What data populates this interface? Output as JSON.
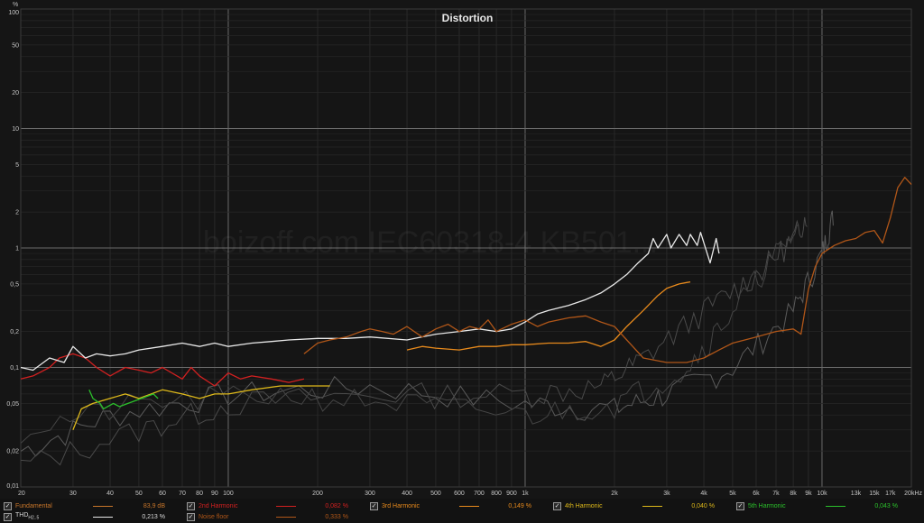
{
  "watermark": "boizoff.com IEC60318-4 KB501...",
  "chart_data": {
    "type": "line",
    "title": "Distortion",
    "yunit": "%",
    "xunit": "Hz",
    "xscale": "log",
    "yscale": "log",
    "xlim": [
      20,
      20000
    ],
    "ylim": [
      0.01,
      100
    ],
    "grid": true,
    "legend_placement": "bottom",
    "x_ticks": [
      {
        "v": 20,
        "t": "20"
      },
      {
        "v": 30,
        "t": "30"
      },
      {
        "v": 40,
        "t": "40"
      },
      {
        "v": 50,
        "t": "50"
      },
      {
        "v": 60,
        "t": "60"
      },
      {
        "v": 70,
        "t": "70"
      },
      {
        "v": 80,
        "t": "80"
      },
      {
        "v": 90,
        "t": "90"
      },
      {
        "v": 100,
        "t": "100"
      },
      {
        "v": 200,
        "t": "200"
      },
      {
        "v": 300,
        "t": "300"
      },
      {
        "v": 400,
        "t": "400"
      },
      {
        "v": 500,
        "t": "500"
      },
      {
        "v": 600,
        "t": "600"
      },
      {
        "v": 700,
        "t": "700"
      },
      {
        "v": 800,
        "t": "800"
      },
      {
        "v": 900,
        "t": "900"
      },
      {
        "v": 1000,
        "t": "1k"
      },
      {
        "v": 2000,
        "t": "2k"
      },
      {
        "v": 3000,
        "t": "3k"
      },
      {
        "v": 4000,
        "t": "4k"
      },
      {
        "v": 5000,
        "t": "5k"
      },
      {
        "v": 6000,
        "t": "6k"
      },
      {
        "v": 7000,
        "t": "7k"
      },
      {
        "v": 8000,
        "t": "8k"
      },
      {
        "v": 9000,
        "t": "9k"
      },
      {
        "v": 10000,
        "t": "10k"
      },
      {
        "v": 13000,
        "t": "13k"
      },
      {
        "v": 15000,
        "t": "15k"
      },
      {
        "v": 17000,
        "t": "17k"
      },
      {
        "v": 20000,
        "t": "20kHz"
      }
    ],
    "y_ticks": [
      {
        "v": 0.01,
        "t": "0,01"
      },
      {
        "v": 0.02,
        "t": "0,02"
      },
      {
        "v": 0.05,
        "t": "0,05"
      },
      {
        "v": 0.1,
        "t": "0,1"
      },
      {
        "v": 0.2,
        "t": "0,2"
      },
      {
        "v": 0.5,
        "t": "0,5"
      },
      {
        "v": 1,
        "t": "1"
      },
      {
        "v": 2,
        "t": "2"
      },
      {
        "v": 5,
        "t": "5"
      },
      {
        "v": 10,
        "t": "10"
      },
      {
        "v": 20,
        "t": "20"
      },
      {
        "v": 50,
        "t": "50"
      },
      {
        "v": 100,
        "t": "100"
      }
    ],
    "series": [
      {
        "name": "Fundamental",
        "color": "#c8762a",
        "value": "83,9 dB",
        "show_line": false,
        "points": []
      },
      {
        "name": "2nd Harmonic",
        "color": "#d22020",
        "value": "0,082 %",
        "points": [
          [
            20,
            0.08
          ],
          [
            22,
            0.085
          ],
          [
            25,
            0.1
          ],
          [
            27,
            0.12
          ],
          [
            30,
            0.13
          ],
          [
            33,
            0.12
          ],
          [
            36,
            0.1
          ],
          [
            40,
            0.085
          ],
          [
            45,
            0.1
          ],
          [
            50,
            0.095
          ],
          [
            55,
            0.09
          ],
          [
            60,
            0.1
          ],
          [
            70,
            0.08
          ],
          [
            75,
            0.1
          ],
          [
            80,
            0.085
          ],
          [
            90,
            0.07
          ],
          [
            100,
            0.09
          ],
          [
            110,
            0.08
          ],
          [
            120,
            0.085
          ],
          [
            140,
            0.08
          ],
          [
            160,
            0.075
          ],
          [
            180,
            0.08
          ]
        ]
      },
      {
        "name": "3rd Harmonic",
        "color": "#e88a1c",
        "value": "0,149 %",
        "points": [
          [
            400,
            0.14
          ],
          [
            450,
            0.15
          ],
          [
            500,
            0.145
          ],
          [
            600,
            0.14
          ],
          [
            700,
            0.15
          ],
          [
            800,
            0.15
          ],
          [
            900,
            0.155
          ],
          [
            1000,
            0.155
          ],
          [
            1200,
            0.16
          ],
          [
            1400,
            0.16
          ],
          [
            1600,
            0.165
          ],
          [
            1800,
            0.15
          ],
          [
            2000,
            0.17
          ],
          [
            2200,
            0.22
          ],
          [
            2500,
            0.3
          ],
          [
            2800,
            0.4
          ],
          [
            3000,
            0.46
          ],
          [
            3300,
            0.5
          ],
          [
            3600,
            0.52
          ]
        ]
      },
      {
        "name": "4th Harmonic",
        "color": "#ddb81a",
        "value": "0,040 %",
        "points": [
          [
            30,
            0.03
          ],
          [
            32,
            0.045
          ],
          [
            35,
            0.05
          ],
          [
            45,
            0.06
          ],
          [
            50,
            0.055
          ],
          [
            60,
            0.065
          ],
          [
            70,
            0.06
          ],
          [
            80,
            0.055
          ],
          [
            90,
            0.06
          ],
          [
            100,
            0.06
          ],
          [
            120,
            0.065
          ],
          [
            150,
            0.07
          ],
          [
            180,
            0.07
          ],
          [
            220,
            0.07
          ]
        ]
      },
      {
        "name": "5th Harmonic",
        "color": "#2bc02b",
        "value": "0,043 %",
        "points": [
          [
            34,
            0.065
          ],
          [
            35,
            0.055
          ],
          [
            37,
            0.05
          ],
          [
            38,
            0.045
          ],
          [
            41,
            0.05
          ],
          [
            43,
            0.047
          ],
          [
            56,
            0.06
          ],
          [
            58,
            0.055
          ]
        ]
      },
      {
        "name": "THD",
        "sub": "H2..5",
        "color": "#e8e8e8",
        "value": "0,213 %",
        "points": [
          [
            20,
            0.1
          ],
          [
            22,
            0.095
          ],
          [
            25,
            0.12
          ],
          [
            28,
            0.11
          ],
          [
            30,
            0.15
          ],
          [
            33,
            0.12
          ],
          [
            36,
            0.13
          ],
          [
            40,
            0.125
          ],
          [
            45,
            0.13
          ],
          [
            50,
            0.14
          ],
          [
            60,
            0.15
          ],
          [
            70,
            0.16
          ],
          [
            80,
            0.15
          ],
          [
            90,
            0.16
          ],
          [
            100,
            0.15
          ],
          [
            120,
            0.16
          ],
          [
            140,
            0.165
          ],
          [
            160,
            0.17
          ],
          [
            200,
            0.175
          ],
          [
            250,
            0.175
          ],
          [
            300,
            0.18
          ],
          [
            400,
            0.17
          ],
          [
            500,
            0.19
          ],
          [
            600,
            0.2
          ],
          [
            700,
            0.21
          ],
          [
            800,
            0.2
          ],
          [
            900,
            0.21
          ],
          [
            1000,
            0.24
          ],
          [
            1100,
            0.28
          ],
          [
            1200,
            0.3
          ],
          [
            1400,
            0.33
          ],
          [
            1600,
            0.37
          ],
          [
            1800,
            0.42
          ],
          [
            2000,
            0.5
          ],
          [
            2200,
            0.6
          ],
          [
            2400,
            0.75
          ],
          [
            2600,
            0.9
          ],
          [
            2700,
            1.2
          ],
          [
            2800,
            1.0
          ],
          [
            3000,
            1.3
          ],
          [
            3100,
            1.0
          ],
          [
            3300,
            1.3
          ],
          [
            3500,
            1.05
          ],
          [
            3600,
            1.3
          ],
          [
            3800,
            1.05
          ],
          [
            3900,
            1.35
          ],
          [
            4200,
            0.75
          ],
          [
            4400,
            1.2
          ],
          [
            4500,
            0.9
          ]
        ]
      },
      {
        "name": "Noise floor",
        "color": "#b05618",
        "value": "0,333 %",
        "points": [
          [
            180,
            0.13
          ],
          [
            200,
            0.16
          ],
          [
            220,
            0.17
          ],
          [
            250,
            0.18
          ],
          [
            280,
            0.2
          ],
          [
            300,
            0.21
          ],
          [
            330,
            0.2
          ],
          [
            360,
            0.19
          ],
          [
            400,
            0.22
          ],
          [
            450,
            0.18
          ],
          [
            500,
            0.21
          ],
          [
            550,
            0.23
          ],
          [
            600,
            0.2
          ],
          [
            650,
            0.22
          ],
          [
            700,
            0.21
          ],
          [
            750,
            0.25
          ],
          [
            800,
            0.2
          ],
          [
            900,
            0.23
          ],
          [
            1000,
            0.25
          ],
          [
            1100,
            0.22
          ],
          [
            1200,
            0.24
          ],
          [
            1400,
            0.26
          ],
          [
            1600,
            0.27
          ],
          [
            1800,
            0.24
          ],
          [
            2000,
            0.22
          ],
          [
            2200,
            0.17
          ],
          [
            2500,
            0.12
          ],
          [
            3000,
            0.11
          ],
          [
            3500,
            0.11
          ],
          [
            4000,
            0.12
          ],
          [
            4500,
            0.14
          ],
          [
            5000,
            0.16
          ],
          [
            6000,
            0.18
          ],
          [
            7000,
            0.2
          ],
          [
            8000,
            0.21
          ],
          [
            8500,
            0.19
          ],
          [
            9000,
            0.45
          ],
          [
            9500,
            0.7
          ],
          [
            10000,
            0.9
          ],
          [
            11000,
            1.05
          ],
          [
            12000,
            1.15
          ],
          [
            13000,
            1.2
          ],
          [
            14000,
            1.35
          ],
          [
            15000,
            1.4
          ],
          [
            16000,
            1.1
          ],
          [
            17000,
            1.8
          ],
          [
            18000,
            3.2
          ],
          [
            19000,
            3.9
          ],
          [
            20000,
            3.4
          ]
        ]
      }
    ]
  }
}
